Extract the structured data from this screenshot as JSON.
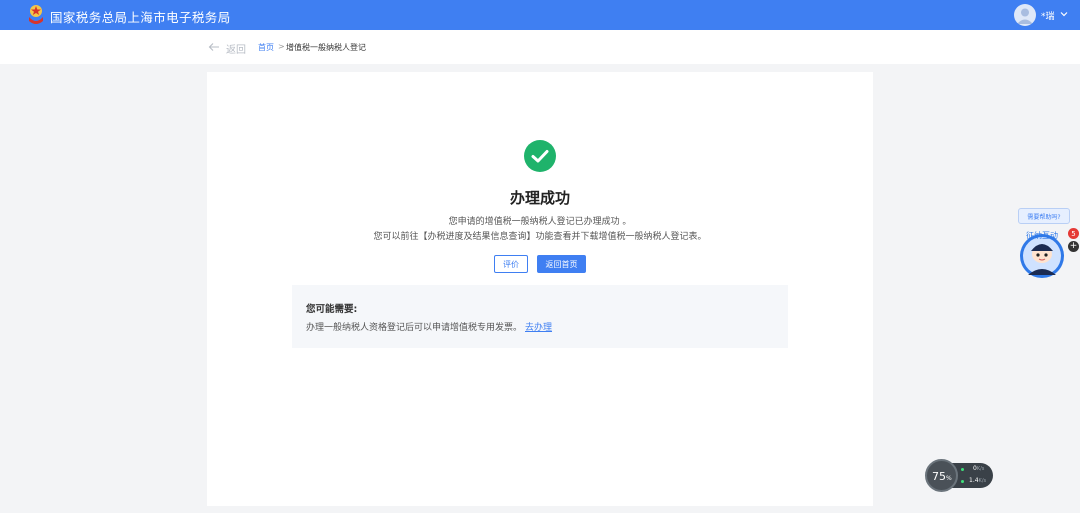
{
  "header": {
    "site_title": "国家税务总局上海市电子税务局",
    "user_name": "*瑞",
    "brand_color": "#3f7ff2"
  },
  "breadcrumb_bar": {
    "back_label": "返回",
    "items": [
      "首页",
      "增值税一般纳税人登记"
    ],
    "separator": ">"
  },
  "result": {
    "icon": "check-circle-icon",
    "icon_color": "#1fb36b",
    "title": "办理成功",
    "line1": "您申请的增值税一般纳税人登记已办理成功 。",
    "line2": "您可以前往【办税进度及结果信息查询】功能查看并下载增值税一般纳税人登记表。",
    "buttons": {
      "rate": "评价",
      "home": "返回首页"
    }
  },
  "suggestion": {
    "title": "您可能需要:",
    "text": "办理一般纳税人资格登记后可以申请增值税专用发票。",
    "link": "去办理"
  },
  "assistant": {
    "bubble": "需要帮助吗?",
    "avatar_text": "征纳互动",
    "badge_count": "5",
    "plus": "+"
  },
  "net_monitor": {
    "percent": "75",
    "percent_unit": "%",
    "upload": "0",
    "upload_unit": "K/s",
    "download": "1.4",
    "download_unit": "K/s"
  }
}
